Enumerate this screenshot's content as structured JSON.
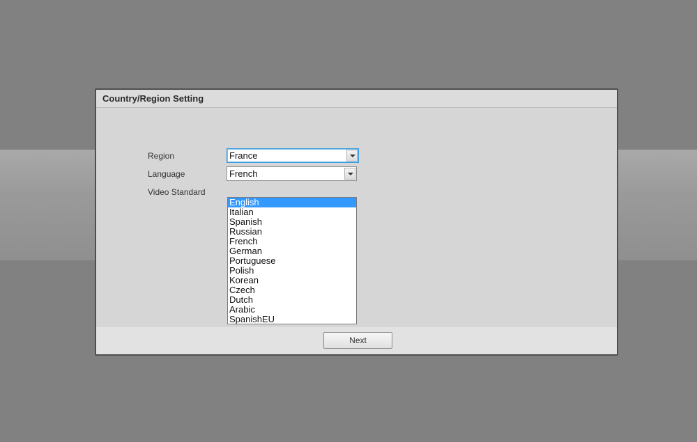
{
  "dialog": {
    "title": "Country/Region Setting"
  },
  "form": {
    "region_label": "Region",
    "region_value": "France",
    "language_label": "Language",
    "language_value": "French",
    "video_standard_label": "Video Standard"
  },
  "language_dropdown": {
    "options": [
      "English",
      "Italian",
      "Spanish",
      "Russian",
      "French",
      "German",
      "Portuguese",
      "Polish",
      "Korean",
      "Czech",
      "Dutch",
      "Arabic",
      "SpanishEU"
    ],
    "highlighted": "English"
  },
  "footer": {
    "next_label": "Next"
  }
}
